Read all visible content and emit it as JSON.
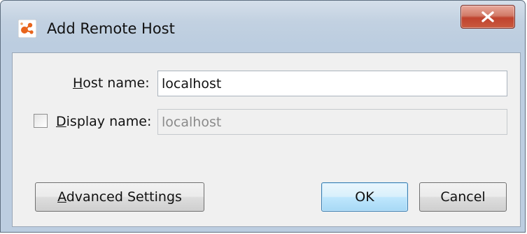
{
  "window": {
    "title": "Add Remote Host",
    "icon": "app-logo-icon",
    "close_icon": "close-icon"
  },
  "form": {
    "host_name": {
      "label_mnemonic": "H",
      "label_rest": "ost name:",
      "value": "localhost"
    },
    "display_name": {
      "checked": false,
      "label_mnemonic": "D",
      "label_rest": "isplay name:",
      "value": "localhost",
      "enabled": false
    }
  },
  "buttons": {
    "advanced_mnemonic": "A",
    "advanced_rest": "dvanced Settings",
    "ok": "OK",
    "cancel": "Cancel"
  },
  "colors": {
    "title_bar": "#c2d1e1",
    "client_bg": "#f0f0f0",
    "close_button": "#c0432e",
    "default_button": "#3c7fb1",
    "icon_accent": "#e8641c"
  }
}
